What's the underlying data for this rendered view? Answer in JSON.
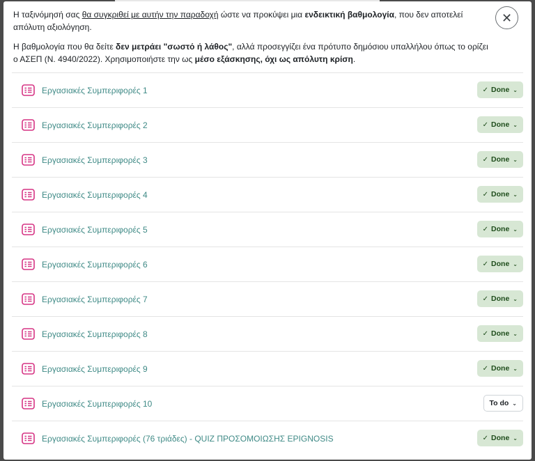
{
  "intro": {
    "p1_a": "Η ταξινόμησή σας ",
    "p1_u": "θα συγκριθεί με αυτήν την παραδοχή",
    "p1_b": " ώστε να προκύψει μια ",
    "p1_strong": "ενδεικτική βαθμολογία",
    "p1_c": ", που δεν αποτελεί απόλυτη αξιολόγηση.",
    "p2_a": "Η βαθμολογία που θα δείτε ",
    "p2_strong1": "δεν μετράει \"σωστό ή λάθος\"",
    "p2_b": ", αλλά προσεγγίζει ένα πρότυπο δημόσιου υπαλλήλου όπως το ορίζει ο ΑΣΕΠ (Ν. 4940/2022). Χρησιμοποιήστε την ως ",
    "p2_strong2": "μέσο εξάσκησης, όχι ως απόλυτη κρίση",
    "p2_c": "."
  },
  "close": {
    "glyph": "✕"
  },
  "icon": {
    "name": "quiz-icon",
    "color": "#d63384"
  },
  "colors": {
    "link": "#3f8a86",
    "done_bg": "#d7e7d4",
    "done_text": "#1f4d1c"
  },
  "activities": [
    {
      "title": "Εργασιακές Συμπεριφορές 1",
      "status": "Done",
      "done": true
    },
    {
      "title": "Εργασιακές Συμπεριφορές 2",
      "status": "Done",
      "done": true
    },
    {
      "title": "Εργασιακές Συμπεριφορές 3",
      "status": "Done",
      "done": true
    },
    {
      "title": "Εργασιακές Συμπεριφορές 4",
      "status": "Done",
      "done": true
    },
    {
      "title": "Εργασιακές Συμπεριφορές 5",
      "status": "Done",
      "done": true
    },
    {
      "title": "Εργασιακές Συμπεριφορές 6",
      "status": "Done",
      "done": true
    },
    {
      "title": "Εργασιακές Συμπεριφορές 7",
      "status": "Done",
      "done": true
    },
    {
      "title": "Εργασιακές Συμπεριφορές 8",
      "status": "Done",
      "done": true
    },
    {
      "title": "Εργασιακές Συμπεριφορές 9",
      "status": "Done",
      "done": true
    },
    {
      "title": "Εργασιακές Συμπεριφορές 10",
      "status": "To do",
      "done": false
    },
    {
      "title": "Εργασιακές Συμπεριφορές (76 τριάδες) - QUIZ ΠΡΟΣΟΜΟΙΩΣΗΣ EPIGNOSIS",
      "status": "Done",
      "done": true
    }
  ]
}
